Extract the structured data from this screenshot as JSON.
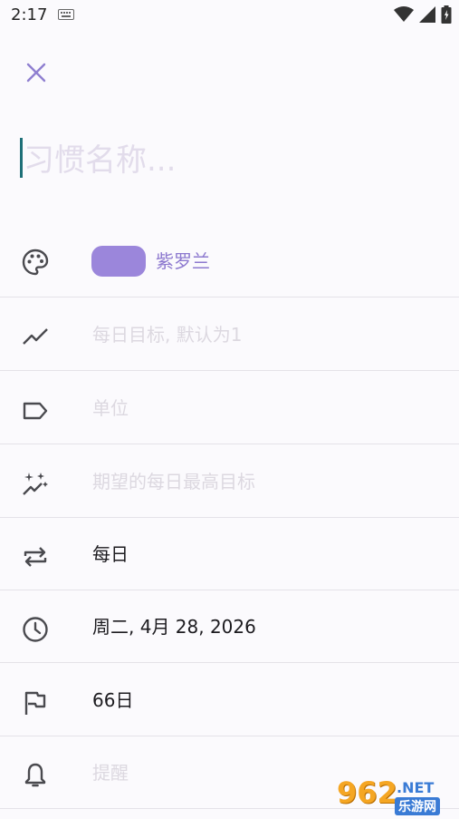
{
  "status_bar": {
    "time": "2:17"
  },
  "close_icon": "close-icon",
  "habit_name": {
    "value": "",
    "placeholder": "习惯名称..."
  },
  "color": {
    "label": "紫罗兰",
    "hex": "#9b86db",
    "label_color": "#8d79cf"
  },
  "rows": {
    "daily_goal": {
      "text": "每日目标, 默认为1",
      "icon": "trend-icon"
    },
    "unit": {
      "text": "单位",
      "icon": "label-icon"
    },
    "max_goal": {
      "text": "期望的每日最高目标",
      "icon": "sparkle-trend-icon"
    },
    "repeat": {
      "text": "每日",
      "icon": "repeat-icon"
    },
    "start_date": {
      "text": "周二, 4月 28, 2026",
      "icon": "clock-icon"
    },
    "duration": {
      "text": "66日",
      "icon": "flag-icon"
    },
    "reminder": {
      "text": "提醒",
      "icon": "bell-icon"
    }
  },
  "watermark": {
    "number": "962",
    "site": ".NET",
    "sub": "乐游网"
  },
  "colors": {
    "icon": "#4a4a4f",
    "accent": "#1e7078",
    "divider": "#e4e2e8"
  }
}
